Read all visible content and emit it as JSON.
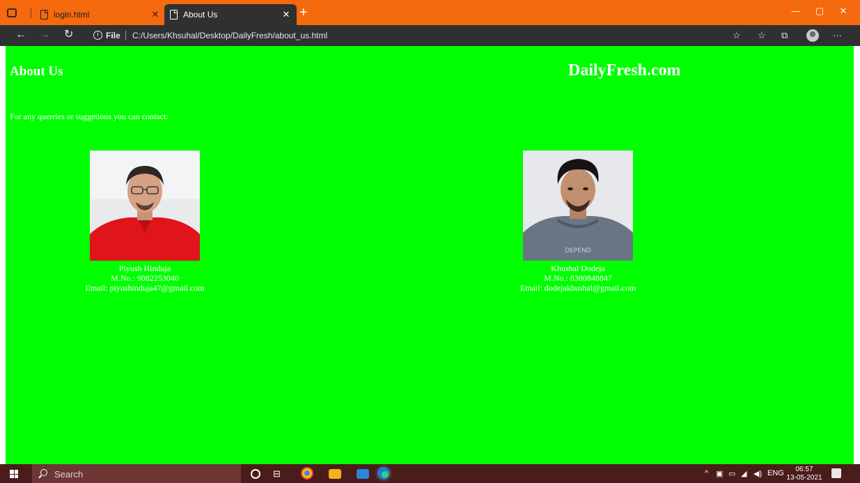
{
  "browser": {
    "tabs": [
      {
        "title": "login.html",
        "active": false
      },
      {
        "title": "About Us",
        "active": true
      }
    ],
    "close_glyph": "✕",
    "new_tab_glyph": "+",
    "window_controls": {
      "minimize": "—",
      "maximize": "▢",
      "close": "✕"
    },
    "address": {
      "scheme_label": "File",
      "url": "C:/Users/Khsuhal/Desktop/DailyFresh/about_us.html"
    },
    "accent_color": "#f5690f",
    "chrome_color": "#303030"
  },
  "page": {
    "heading": "About Us",
    "site_title": "DailyFresh.com",
    "contact_intro": "For any querries or suggetions you can contact:",
    "background_color": "#00ff00",
    "people": [
      {
        "name": "Piyush Hinduja",
        "mobile": "M.No.: 9082253040",
        "email": "Email: piyushinduja47@gmail.com",
        "shirt_color": "#e0151b"
      },
      {
        "name": "Khushal Dodeja",
        "mobile": "M.No.: 8380848847",
        "email": "Email: dodejakhushal@gmail.com",
        "shirt_color": "#6a7583"
      }
    ]
  },
  "taskbar": {
    "search_placeholder": "Search",
    "language": "ENG",
    "time": "06:57",
    "date": "13-05-2021"
  }
}
